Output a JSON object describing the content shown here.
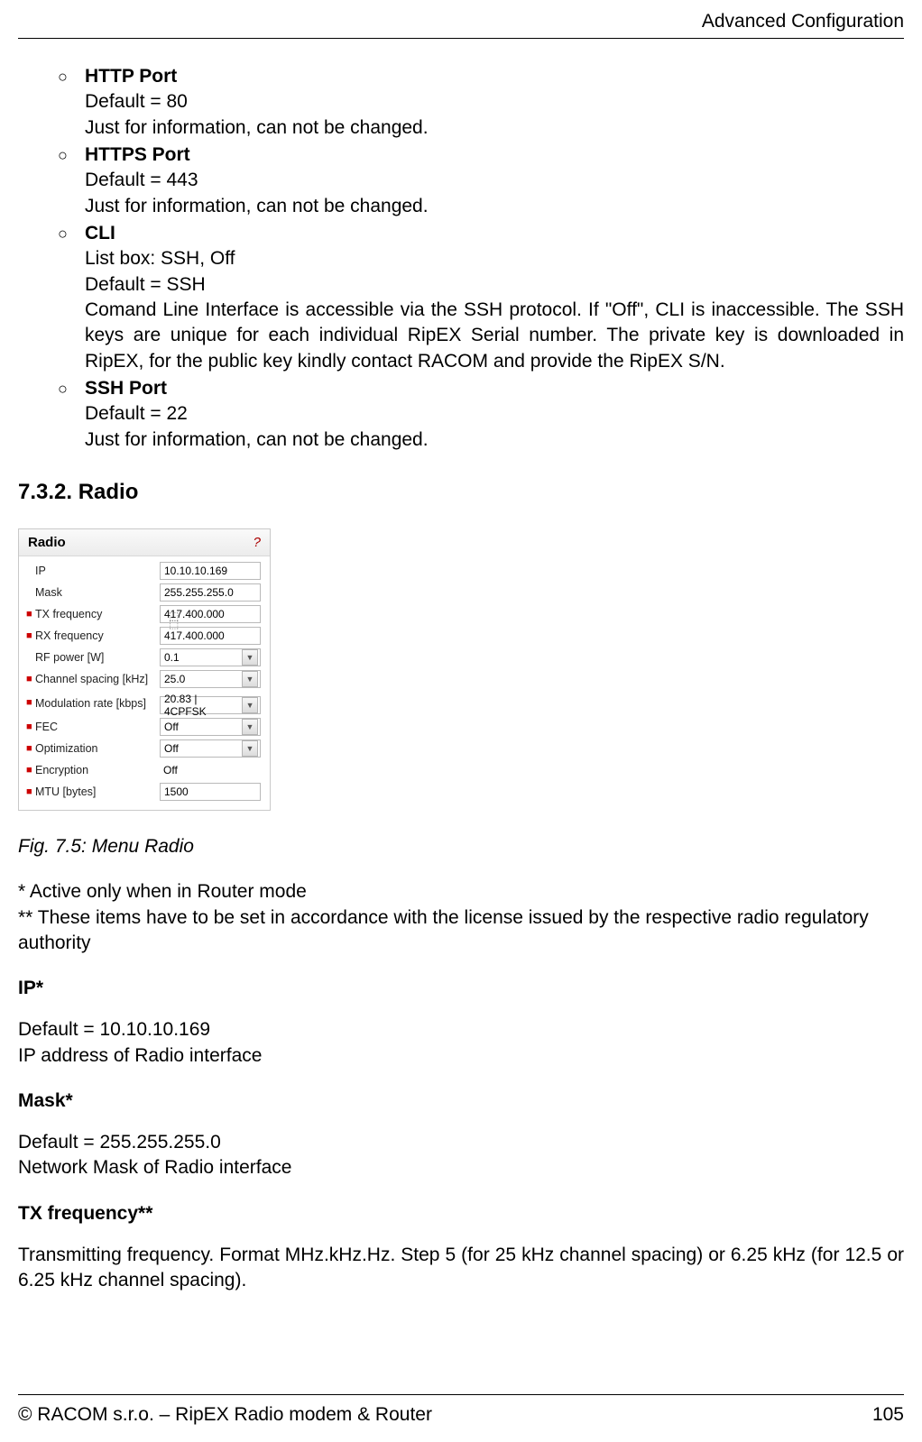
{
  "header": {
    "title": "Advanced Configuration"
  },
  "list": [
    {
      "term": "HTTP Port",
      "lines": [
        "Default = 80",
        "Just for information, can not be changed."
      ]
    },
    {
      "term": "HTTPS Port",
      "lines": [
        "Default = 443",
        "Just for information, can not be changed."
      ]
    },
    {
      "term": "CLI",
      "lines": [
        "List box: SSH, Off",
        "Default = SSH"
      ],
      "justified": "Comand Line Interface is accessible via the SSH protocol. If \"Off\", CLI is inaccessible. The SSH keys are unique for each individual RipEX Serial number. The private key is downloaded in RipEX, for the public key kindly contact RACOM and provide the RipEX S/N."
    },
    {
      "term": "SSH Port",
      "lines": [
        "Default = 22",
        "Just for information, can not be changed."
      ]
    }
  ],
  "section_heading": "7.3.2. Radio",
  "panel": {
    "title": "Radio",
    "help": "?",
    "rows": [
      {
        "mark": "",
        "label": "IP",
        "type": "text",
        "value": "10.10.10.169"
      },
      {
        "mark": "",
        "label": "Mask",
        "type": "text",
        "value": "255.255.255.0"
      },
      {
        "mark": "■",
        "label": "TX frequency",
        "type": "text",
        "value": "417.400.000"
      },
      {
        "mark": "■",
        "label": "RX frequency",
        "type": "text",
        "value": "417.400.000"
      },
      {
        "mark": "",
        "label": "RF power [W]",
        "type": "select",
        "value": "0.1"
      },
      {
        "mark": "■",
        "label": "Channel spacing [kHz]",
        "type": "select",
        "value": "25.0"
      },
      {
        "mark": "■",
        "label": "Modulation rate [kbps]",
        "type": "select",
        "value": "20.83 | 4CPFSK"
      },
      {
        "mark": "■",
        "label": "FEC",
        "type": "select",
        "value": "Off"
      },
      {
        "mark": "■",
        "label": "Optimization",
        "type": "select",
        "value": "Off"
      },
      {
        "mark": "■",
        "label": "Encryption",
        "type": "plain",
        "value": "Off"
      },
      {
        "mark": "■",
        "label": "MTU [bytes]",
        "type": "text",
        "value": "1500"
      }
    ]
  },
  "fig_caption": "Fig. 7.5: Menu Radio",
  "notes": {
    "n1": "* Active only when in Router mode",
    "n2": "** These items have to be set in accordance with the license issued by the respective radio regulatory authority"
  },
  "defs": [
    {
      "term": "IP*",
      "lines": [
        "Default = 10.10.10.169",
        "IP address of Radio interface"
      ]
    },
    {
      "term": "Mask*",
      "lines": [
        "Default = 255.255.255.0",
        "Network Mask of Radio interface"
      ]
    },
    {
      "term": "TX frequency**",
      "justified": "Transmitting frequency. Format MHz.kHz.Hz. Step 5 (for 25 kHz channel spacing) or 6.25 kHz (for 12.5 or 6.25 kHz channel spacing)."
    }
  ],
  "footer": {
    "left": "© RACOM s.r.o. – RipEX Radio modem & Router",
    "right": "105"
  }
}
